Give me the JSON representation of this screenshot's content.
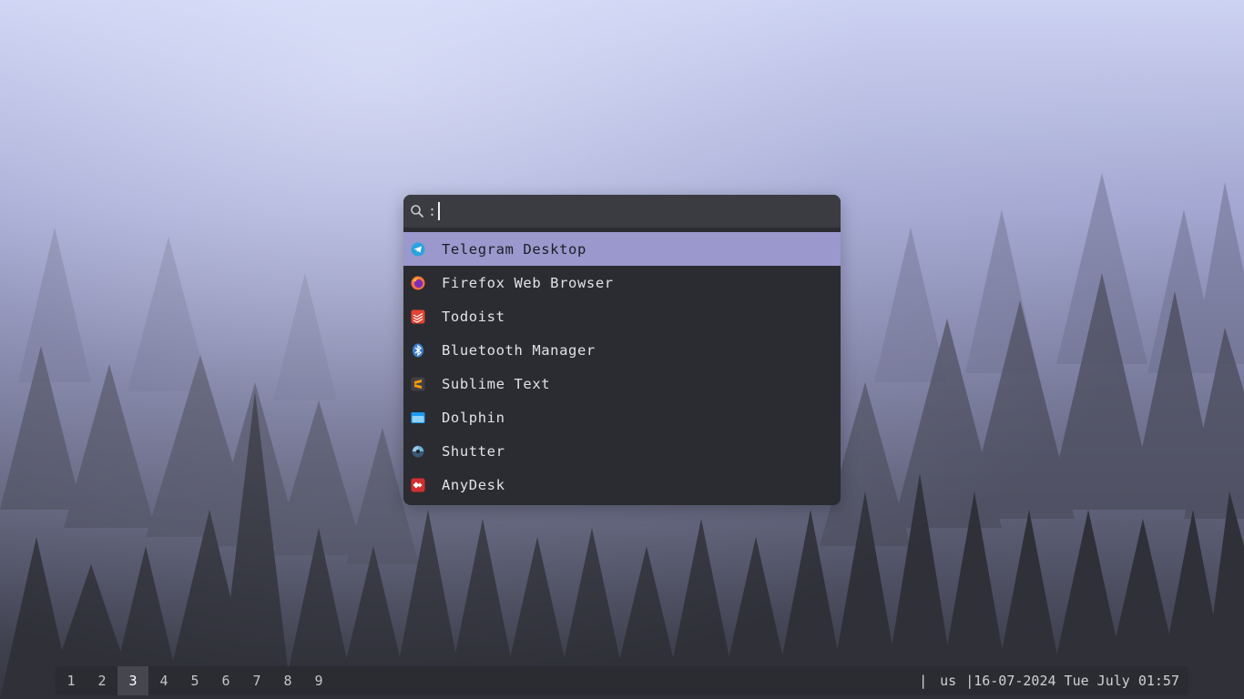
{
  "launcher": {
    "prompt": ":",
    "query": "",
    "results": [
      {
        "label": "Telegram Desktop",
        "icon": "telegram-icon",
        "selected": true
      },
      {
        "label": "Firefox Web Browser",
        "icon": "firefox-icon",
        "selected": false
      },
      {
        "label": "Todoist",
        "icon": "todoist-icon",
        "selected": false
      },
      {
        "label": "Bluetooth Manager",
        "icon": "bluetooth-icon",
        "selected": false
      },
      {
        "label": "Sublime Text",
        "icon": "sublime-text-icon",
        "selected": false
      },
      {
        "label": "Dolphin",
        "icon": "dolphin-folder-icon",
        "selected": false
      },
      {
        "label": "Shutter",
        "icon": "shutter-icon",
        "selected": false
      },
      {
        "label": "AnyDesk",
        "icon": "anydesk-icon",
        "selected": false
      }
    ]
  },
  "bar": {
    "workspaces": [
      "1",
      "2",
      "3",
      "4",
      "5",
      "6",
      "7",
      "8",
      "9"
    ],
    "active_workspace": "3",
    "separator1": "|",
    "keyboard_layout": "us",
    "separator2": "|",
    "datetime": "16-07-2024 Tue July 01:57"
  },
  "colors": {
    "launcher_bg": "#2b2c31",
    "search_bg": "#3b3c42",
    "selected_bg": "#9b98ce",
    "bar_bg": "#2b2c31",
    "active_ws_bg": "#45464e"
  }
}
